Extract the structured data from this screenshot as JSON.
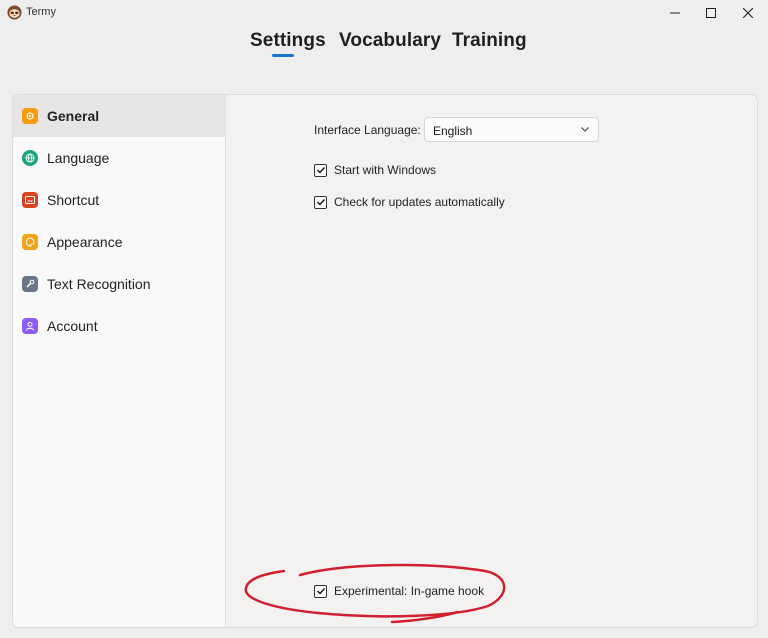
{
  "window": {
    "title": "Termy"
  },
  "tabs": [
    {
      "label": "Settings"
    },
    {
      "label": "Vocabulary"
    },
    {
      "label": "Training"
    }
  ],
  "active_tab": "Settings",
  "sidebar": {
    "items": [
      {
        "label": "General",
        "icon": "gear-icon",
        "color": "#f59a0c"
      },
      {
        "label": "Language",
        "icon": "globe-icon",
        "color": "#1ba37a"
      },
      {
        "label": "Shortcut",
        "icon": "keyboard-icon",
        "color": "#d9431e"
      },
      {
        "label": "Appearance",
        "icon": "palette-icon",
        "color": "#f2a31b"
      },
      {
        "label": "Text Recognition",
        "icon": "wrench-icon",
        "color": "#6b7686"
      },
      {
        "label": "Account",
        "icon": "user-icon",
        "color": "#8b5cf6"
      }
    ],
    "active": "General"
  },
  "general": {
    "language_label": "Interface Language:",
    "language_value": "English",
    "start_with_windows": {
      "label": "Start with Windows",
      "checked": true
    },
    "check_updates": {
      "label": "Check for updates automatically",
      "checked": true
    },
    "experimental_hook": {
      "label": "Experimental: In-game hook",
      "checked": true
    }
  },
  "colors": {
    "accent": "#1a73d0",
    "annotation": "#d0202e"
  }
}
